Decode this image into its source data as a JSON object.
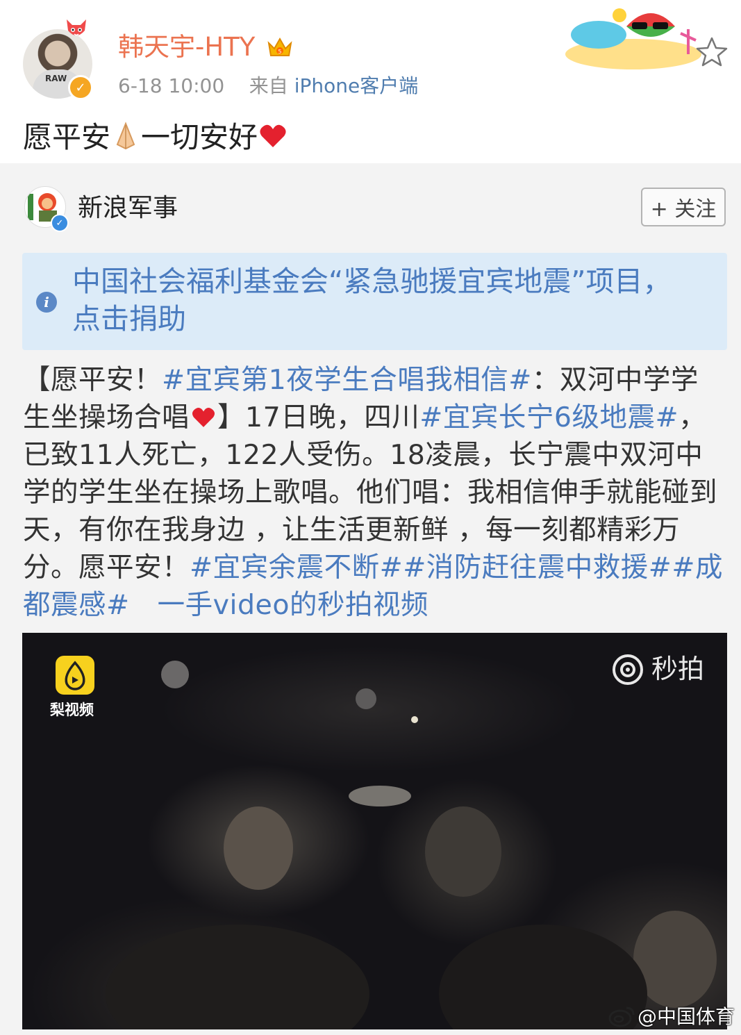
{
  "post": {
    "username": "韩天宇-HTY",
    "time": "6-18 10:00",
    "source_prefix": "来自",
    "source_app": "iPhone客户端",
    "text_before_emoji": "愿平安",
    "text_after_emoji": "一切安好",
    "brand_color": "#eb7350"
  },
  "repost": {
    "source_name": "新浪军事",
    "follow_label": "+ 关注",
    "notice": "中国社会福利基金会“紧急驰援宜宾地震”项目，点击捐助",
    "body": {
      "p1": "【愿平安！",
      "tag1": "#宜宾第1夜学生合唱我相信#",
      "p2": "：双河中学学生坐操场合唱",
      "p3": "】17日晚，四川",
      "tag2": "#宜宾长宁6级地震#",
      "p4": "，已致11人死亡，122人受伤。18凌晨，长宁震中双河中学的学生坐在操场上歌唱。他们唱：我相信伸手就能碰到天，有你在我身边 ，让生活更新鲜 ，每一刻都精彩万分。愿平安！",
      "tag3": "#宜宾余震不断#",
      "tag4": "#消防赶往震中救援#",
      "tag5": "#成都震感#",
      "p5": "　",
      "video_link": "一手video的秒拍视频"
    },
    "link_color": "#4a7bbf"
  },
  "video": {
    "pear_label": "梨视频",
    "miaopai_label": "秒拍",
    "watermark": "@中国体育"
  }
}
